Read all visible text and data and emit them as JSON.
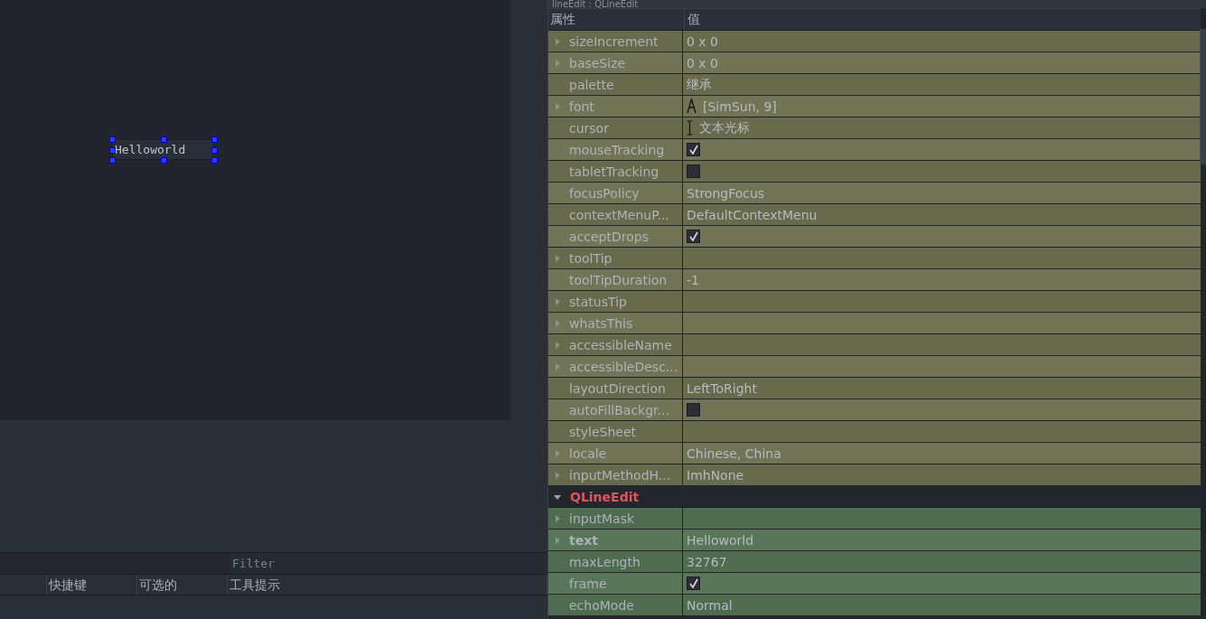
{
  "form_canvas": {
    "line_edit": {
      "value": "Helloworld",
      "selected": true
    }
  },
  "action_editor": {
    "filter": {
      "placeholder": "Filter"
    },
    "columns": [
      "",
      "快捷键",
      "可选的",
      "工具提示"
    ]
  },
  "property_editor": {
    "title": "lineEdit : QLineEdit",
    "columns": [
      "属性",
      "值"
    ],
    "groups": [
      {
        "color": "#686a4c",
        "rows": [
          {
            "name": "sizeIncrement",
            "value": "0 x 0",
            "kind": "text",
            "expandable": true,
            "modified": false
          },
          {
            "name": "baseSize",
            "value": "0 x 0",
            "kind": "text",
            "expandable": true,
            "modified": false
          },
          {
            "name": "palette",
            "value": "继承",
            "kind": "text",
            "expandable": false,
            "modified": false
          },
          {
            "name": "font",
            "value": "[SimSun, 9]",
            "kind": "font",
            "expandable": true,
            "modified": false
          },
          {
            "name": "cursor",
            "value": "文本光标",
            "kind": "cursor",
            "expandable": false,
            "modified": false
          },
          {
            "name": "mouseTracking",
            "kind": "checkbox",
            "checked": true,
            "expandable": false,
            "modified": false
          },
          {
            "name": "tabletTracking",
            "kind": "checkbox",
            "checked": false,
            "expandable": false,
            "modified": false
          },
          {
            "name": "focusPolicy",
            "value": "StrongFocus",
            "kind": "text",
            "expandable": false,
            "modified": false
          },
          {
            "name": "contextMenuP...",
            "value": "DefaultContextMenu",
            "kind": "text",
            "expandable": false,
            "modified": false
          },
          {
            "name": "acceptDrops",
            "kind": "checkbox",
            "checked": true,
            "expandable": false,
            "modified": false
          },
          {
            "name": "toolTip",
            "kind": "text",
            "expandable": true,
            "modified": false
          },
          {
            "name": "toolTipDuration",
            "value": "-1",
            "kind": "text",
            "expandable": false,
            "modified": false
          },
          {
            "name": "statusTip",
            "kind": "text",
            "expandable": true,
            "modified": false
          },
          {
            "name": "whatsThis",
            "kind": "text",
            "expandable": true,
            "modified": false
          },
          {
            "name": "accessibleName",
            "kind": "text",
            "expandable": true,
            "modified": false
          },
          {
            "name": "accessibleDesc...",
            "kind": "text",
            "expandable": true,
            "modified": false
          },
          {
            "name": "layoutDirection",
            "value": "LeftToRight",
            "kind": "text",
            "expandable": false,
            "modified": false
          },
          {
            "name": "autoFillBackgr...",
            "kind": "checkbox",
            "checked": false,
            "expandable": false,
            "modified": false
          },
          {
            "name": "styleSheet",
            "kind": "text",
            "expandable": false,
            "modified": false
          },
          {
            "name": "locale",
            "value": "Chinese, China",
            "kind": "text",
            "expandable": true,
            "modified": false
          },
          {
            "name": "inputMethodH...",
            "value": "ImhNone",
            "kind": "text",
            "expandable": true,
            "modified": false
          }
        ]
      },
      {
        "header": "QLineEdit",
        "expanded": true,
        "color": "#4f6b50",
        "rows": [
          {
            "name": "inputMask",
            "kind": "text",
            "expandable": true,
            "modified": false
          },
          {
            "name": "text",
            "value": "Helloworld",
            "kind": "text",
            "expandable": true,
            "modified": true
          },
          {
            "name": "maxLength",
            "value": "32767",
            "kind": "text",
            "expandable": false,
            "modified": false
          },
          {
            "name": "frame",
            "kind": "checkbox",
            "checked": true,
            "expandable": false,
            "modified": false
          },
          {
            "name": "echoMode",
            "value": "Normal",
            "kind": "text",
            "expandable": false,
            "modified": false
          }
        ]
      }
    ]
  }
}
